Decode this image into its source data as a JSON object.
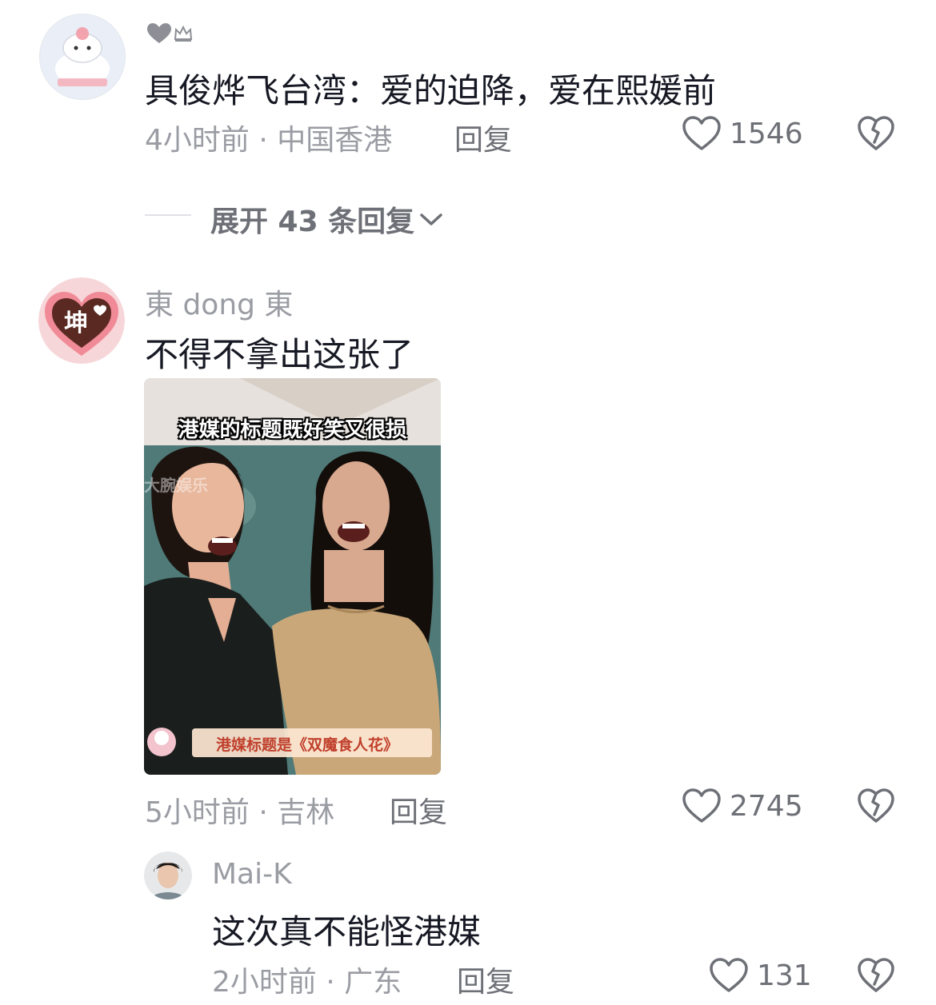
{
  "comments": [
    {
      "badge_icons": [
        "heart-badge-icon",
        "crown-badge-icon"
      ],
      "text": "具俊烨飞台湾：爱的迫降，爱在熙媛前",
      "meta": "4小时前 · 中国香港",
      "reply": "回复",
      "likes": "1546",
      "expand": "展开 43 条回复"
    },
    {
      "username": "東 dong 東",
      "avatar_text": "坤",
      "text": "不得不拿出这张了",
      "image": {
        "top_caption": "港媒的标题既好笑又很损",
        "bottom_caption": "港媒标题是《双魔食人花》",
        "watermark": "大腕娱乐"
      },
      "meta": "5小时前 · 吉林",
      "reply": "回复",
      "likes": "2745"
    },
    {
      "username": "Mai-K",
      "text": "这次真不能怪港媒",
      "meta": "2小时前 · 广东",
      "reply": "回复",
      "likes": "131"
    }
  ],
  "colors": {
    "meta": "#9a9ca3",
    "text": "#161823",
    "action": "#6e7077"
  }
}
